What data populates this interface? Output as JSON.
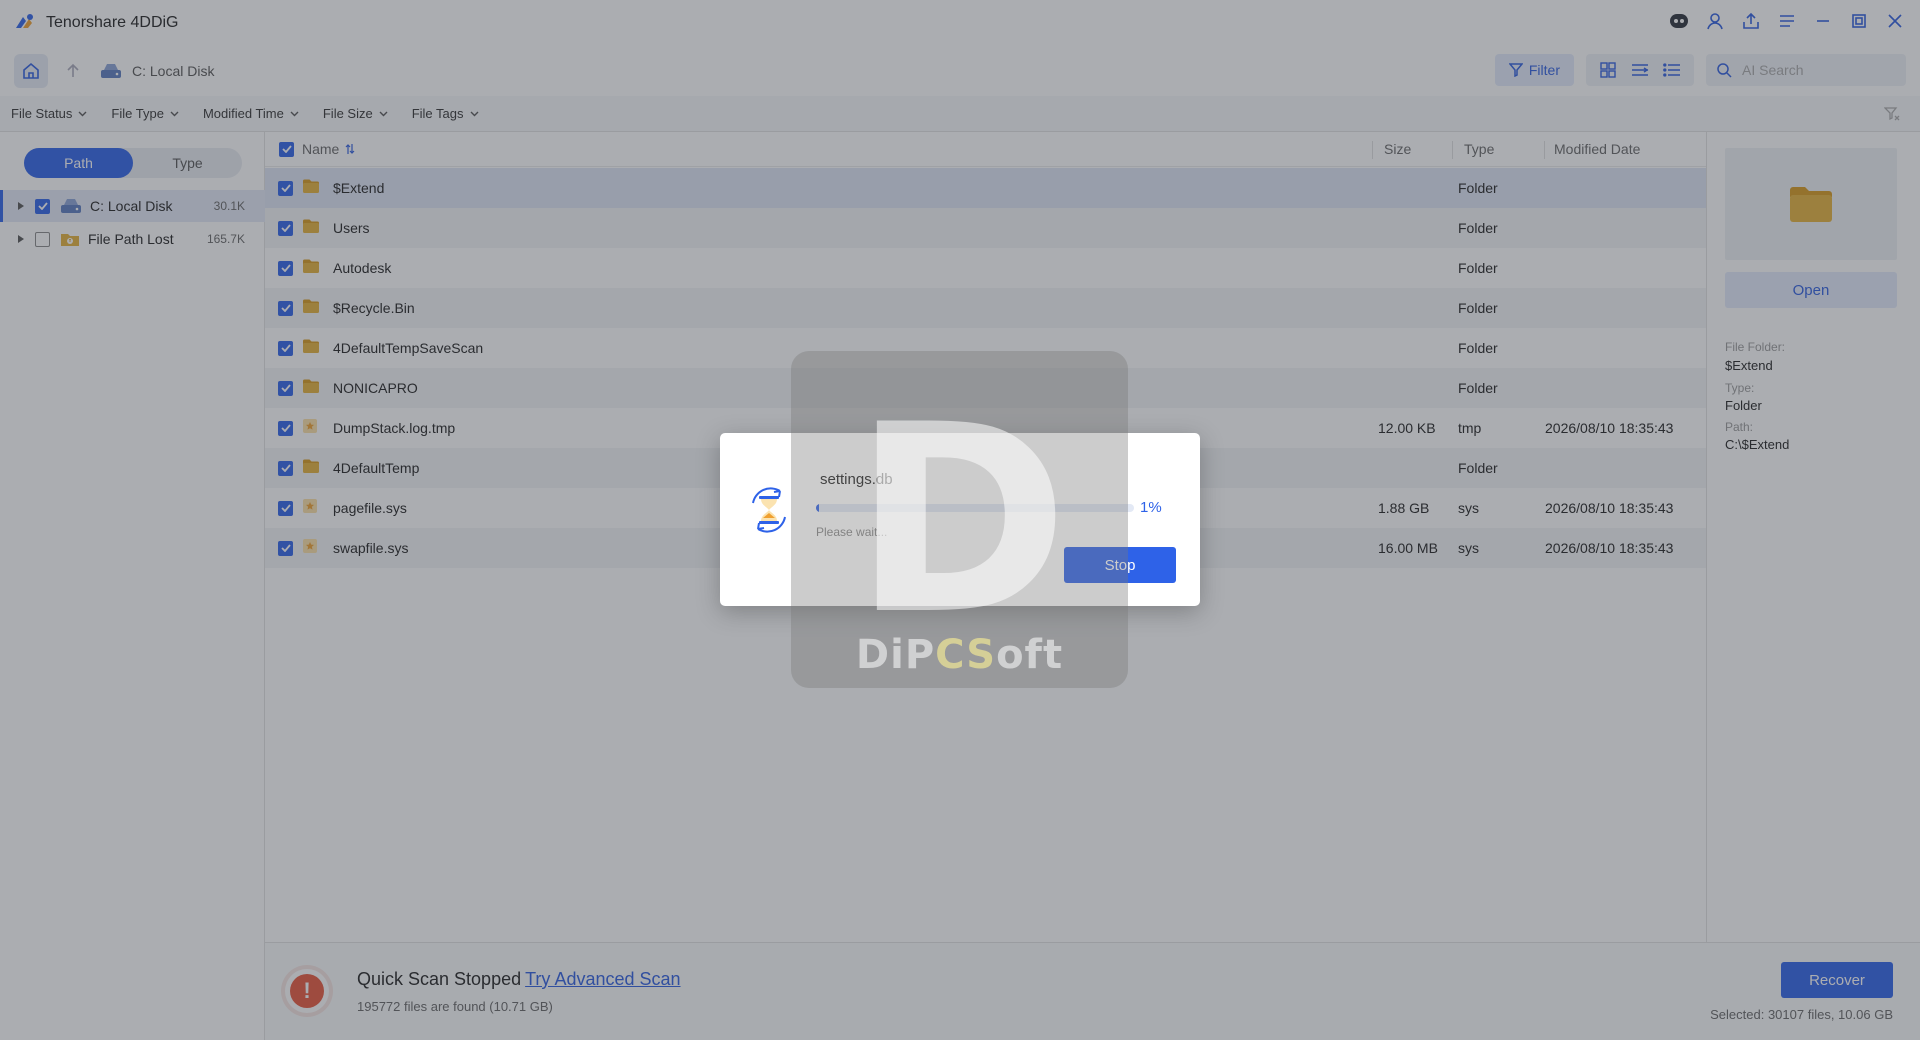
{
  "app": {
    "title": "Tenorshare 4DDiG"
  },
  "navbar": {
    "breadcrumb": "C: Local Disk",
    "filter_label": "Filter",
    "search_placeholder": "AI Search"
  },
  "filters": [
    "File Status",
    "File Type",
    "Modified Time",
    "File Size",
    "File Tags"
  ],
  "sidebar": {
    "tabs": [
      {
        "label": "Path",
        "active": true
      },
      {
        "label": "Type",
        "active": false
      }
    ],
    "tree": [
      {
        "label": "C: Local Disk",
        "count": "30.1K",
        "checked": true,
        "selected": true
      },
      {
        "label": "File Path Lost",
        "count": "165.7K",
        "checked": false,
        "selected": false
      }
    ]
  },
  "table": {
    "headers": {
      "name": "Name",
      "size": "Size",
      "type": "Type",
      "date": "Modified Date"
    },
    "rows": [
      {
        "name": "$Extend",
        "size": "",
        "type": "Folder",
        "date": "",
        "icon": "folder-icon"
      },
      {
        "name": "Users",
        "size": "",
        "type": "Folder",
        "date": "",
        "icon": "folder-icon"
      },
      {
        "name": "Autodesk",
        "size": "",
        "type": "Folder",
        "date": "",
        "icon": "folder-icon"
      },
      {
        "name": "$Recycle.Bin",
        "size": "",
        "type": "Folder",
        "date": "",
        "icon": "folder-icon"
      },
      {
        "name": "4DefaultTempSaveScan",
        "size": "",
        "type": "Folder",
        "date": "",
        "icon": "folder-icon"
      },
      {
        "name": "NONICAPRO",
        "size": "",
        "type": "Folder",
        "date": "",
        "icon": "folder-icon"
      },
      {
        "name": "DumpStack.log.tmp",
        "size": "12.00 KB",
        "type": "tmp",
        "date": "2026/08/10 18:35:43",
        "icon": "file-icon"
      },
      {
        "name": "4DefaultTemp",
        "size": "",
        "type": "Folder",
        "date": "",
        "icon": "folder-icon"
      },
      {
        "name": "pagefile.sys",
        "size": "1.88 GB",
        "type": "sys",
        "date": "2026/08/10 18:35:43",
        "icon": "file-icon"
      },
      {
        "name": "swapfile.sys",
        "size": "16.00 MB",
        "type": "sys",
        "date": "2026/08/10 18:35:43",
        "icon": "file-icon"
      }
    ]
  },
  "details": {
    "open_label": "Open",
    "folder_label": "File Folder:",
    "folder_value": "$Extend",
    "type_label": "Type:",
    "type_value": "Folder",
    "path_label": "Path:",
    "path_value": "C:\\$Extend"
  },
  "status": {
    "title": "Quick Scan Stopped",
    "link": "Try Advanced Scan",
    "subtitle": "195772 files are found (10.71 GB)",
    "recover_label": "Recover",
    "selected": "Selected: 30107 files, 10.06 GB"
  },
  "dialog": {
    "filename": "settings.db",
    "progress_percent": 1,
    "progress_label": "1%",
    "wait_text": "Please wait...",
    "stop_label": "Stop"
  },
  "watermark": {
    "letter": "D",
    "text_a": "DiP",
    "text_b": "CS",
    "text_c": "oft"
  },
  "colors": {
    "accent": "#2e62e8",
    "warning": "#e8573c",
    "folder": "#e6b23a"
  }
}
